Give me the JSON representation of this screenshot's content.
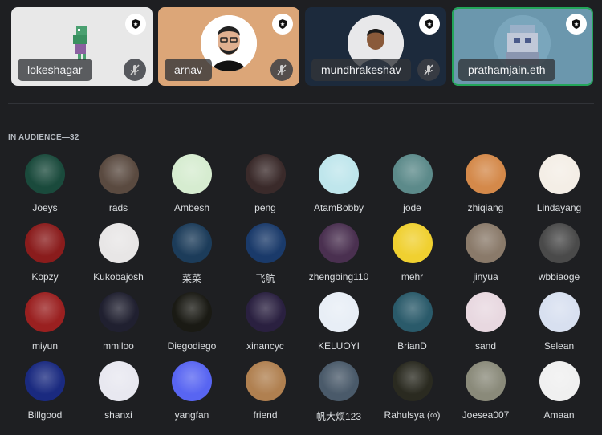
{
  "speakers": [
    {
      "name": "lokeshagar",
      "tile_color": "#e8e8e8",
      "muted": true
    },
    {
      "name": "arnav",
      "tile_color": "#dca678",
      "muted": true
    },
    {
      "name": "mundhrakeshav",
      "tile_color": "#1c2a3c",
      "muted": true
    },
    {
      "name": "prathamjain.eth",
      "tile_color": "#6b97ad",
      "muted": false,
      "speaking": true
    }
  ],
  "audience": {
    "header": "IN AUDIENCE—32",
    "members": [
      {
        "name": "Joeys",
        "color": "#1a4a3c"
      },
      {
        "name": "rads",
        "color": "#5a4a40"
      },
      {
        "name": "Ambesh",
        "color": "#d6ecd0"
      },
      {
        "name": "peng",
        "color": "#3a2a2a"
      },
      {
        "name": "AtamBobby",
        "color": "#bfe6ec"
      },
      {
        "name": "jode",
        "color": "#5c8a8a"
      },
      {
        "name": "zhiqiang",
        "color": "#d4894a"
      },
      {
        "name": "Lindayang",
        "color": "#f4eee6"
      },
      {
        "name": "Kopzy",
        "color": "#8a1c1c"
      },
      {
        "name": "Kukobajosh",
        "color": "#e8e6e6"
      },
      {
        "name": "菜菜",
        "color": "#1c3c5a"
      },
      {
        "name": "飞航",
        "color": "#1a3a6a"
      },
      {
        "name": "zhengbing110",
        "color": "#4a3050"
      },
      {
        "name": "mehr",
        "color": "#f0d030"
      },
      {
        "name": "jinyua",
        "color": "#8a7a6a"
      },
      {
        "name": "wbbiaoge",
        "color": "#4a4a4a"
      },
      {
        "name": "miyun",
        "color": "#9a2020"
      },
      {
        "name": "mmlloo",
        "color": "#202030"
      },
      {
        "name": "Diegodiego",
        "color": "#1a1a14"
      },
      {
        "name": "xinancyc",
        "color": "#2a2040"
      },
      {
        "name": "KELUOYI",
        "color": "#e8eef6"
      },
      {
        "name": "BrianD",
        "color": "#2a5a6a"
      },
      {
        "name": "sand",
        "color": "#e8d8e0"
      },
      {
        "name": "Selean",
        "color": "#d8e0f0"
      },
      {
        "name": "Billgood",
        "color": "#1a2a80"
      },
      {
        "name": "shanxi",
        "color": "#e8e8f0"
      },
      {
        "name": "yangfan",
        "color": "#5865f2"
      },
      {
        "name": "friend",
        "color": "#b08050"
      },
      {
        "name": "帆大烦123",
        "color": "#4a5a6a"
      },
      {
        "name": "Rahulsya (∞)",
        "color": "#2a2a20"
      },
      {
        "name": "Joesea007",
        "color": "#8a8a7a"
      },
      {
        "name": "Amaan",
        "color": "#f0f0f0"
      }
    ]
  },
  "icons": {
    "shield": "shield-star-icon",
    "muted": "microphone-off-icon"
  },
  "colors": {
    "background": "#1e1f22",
    "speaking_ring": "#23a559"
  }
}
